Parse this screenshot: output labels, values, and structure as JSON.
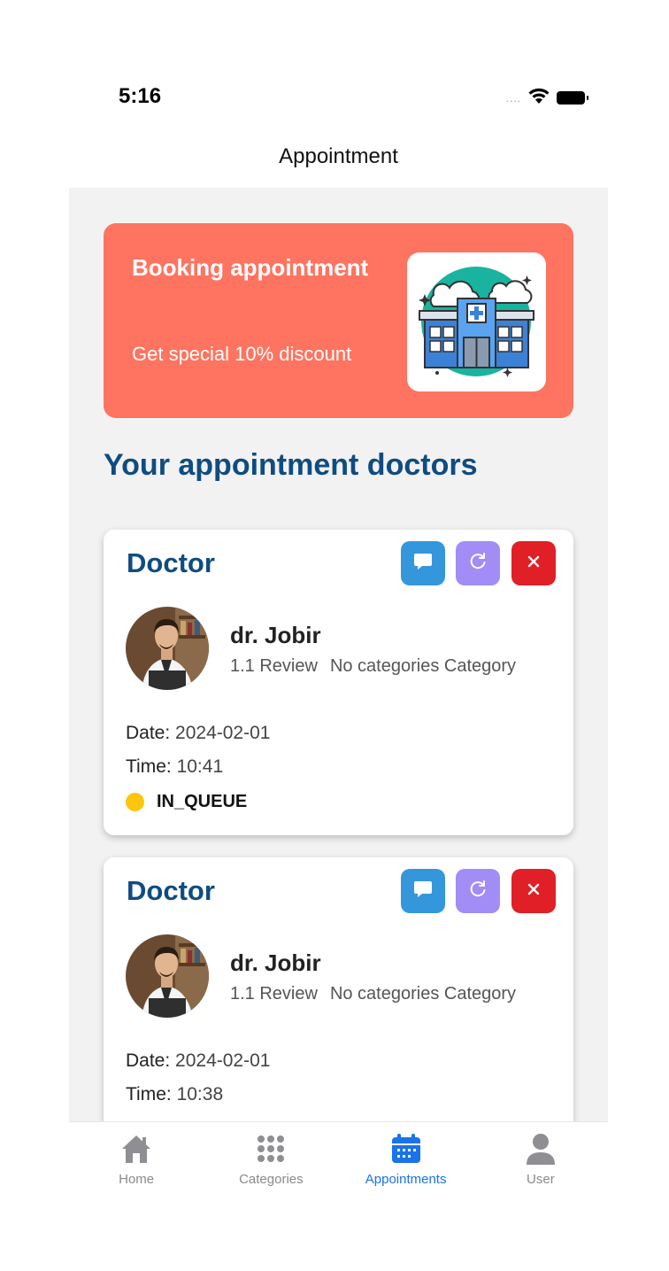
{
  "status_bar": {
    "time": "5:16",
    "signal": "....",
    "icons": [
      "wifi-icon",
      "battery-icon"
    ]
  },
  "header": {
    "title": "Appointment"
  },
  "banner": {
    "title": "Booking appointment",
    "subtitle": "Get special 10% discount",
    "image": "hospital-building-illustration",
    "color": "#fe7460"
  },
  "section": {
    "title": "Your appointment doctors"
  },
  "appointments": [
    {
      "card_title": "Doctor",
      "doctor_name": "dr. Jobir",
      "rating": "1.1 Review",
      "category": "No categories Category",
      "date_label": "Date:",
      "date": "2024-02-01",
      "time_label": "Time:",
      "time": "10:41",
      "status": "IN_QUEUE",
      "status_color": "#fcc60c",
      "actions": [
        "chat-icon",
        "refresh-icon",
        "close-icon"
      ]
    },
    {
      "card_title": "Doctor",
      "doctor_name": "dr. Jobir",
      "rating": "1.1 Review",
      "category": "No categories Category",
      "date_label": "Date:",
      "date": "2024-02-01",
      "time_label": "Time:",
      "time": "10:38",
      "actions": [
        "chat-icon",
        "refresh-icon",
        "close-icon"
      ]
    }
  ],
  "tabbar": {
    "items": [
      {
        "label": "Home",
        "icon": "home-icon",
        "active": false
      },
      {
        "label": "Categories",
        "icon": "grid-dots-icon",
        "active": false
      },
      {
        "label": "Appointments",
        "icon": "calendar-icon",
        "active": true
      },
      {
        "label": "User",
        "icon": "user-icon",
        "active": false
      }
    ]
  },
  "colors": {
    "accent": "#1a73e8",
    "heading": "#0f4c81",
    "chat_button": "#3497db",
    "refresh_button": "#a28cf6",
    "cancel_button": "#e01f26"
  }
}
